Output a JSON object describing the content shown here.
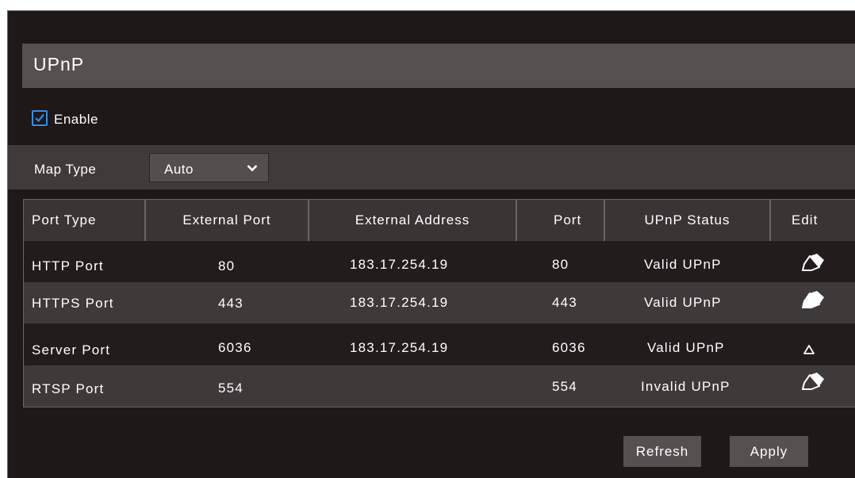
{
  "section": {
    "title": "UPnP"
  },
  "enable": {
    "label": "Enable",
    "checked": true
  },
  "map_type": {
    "label": "Map Type",
    "value": "Auto"
  },
  "table": {
    "headers": [
      "Port Type",
      "External Port",
      "External Address",
      "Port",
      "UPnP Status",
      "Edit"
    ],
    "rows": [
      {
        "port_type": "HTTP Port",
        "external_port": "80",
        "external_address": "183.17.254.19",
        "port": "80",
        "status": "Valid UPnP",
        "edit_icon": "pencil-icon"
      },
      {
        "port_type": "HTTPS Port",
        "external_port": "443",
        "external_address": "183.17.254.19",
        "port": "443",
        "status": "Valid UPnP",
        "edit_icon": "pencil-icon"
      },
      {
        "port_type": "Server Port",
        "external_port": "6036",
        "external_address": "183.17.254.19",
        "port": "6036",
        "status": "Valid UPnP",
        "edit_icon": "triangle-icon"
      },
      {
        "port_type": "RTSP Port",
        "external_port": "554",
        "external_address": "",
        "port": "554",
        "status": "Invalid UPnP",
        "edit_icon": "pencil-icon"
      }
    ]
  },
  "buttons": {
    "refresh": "Refresh",
    "apply": "Apply"
  },
  "colors": {
    "accent": "#2f8ee6",
    "background": "#1f1818",
    "title_bar": "#565150",
    "button": "#555150"
  }
}
